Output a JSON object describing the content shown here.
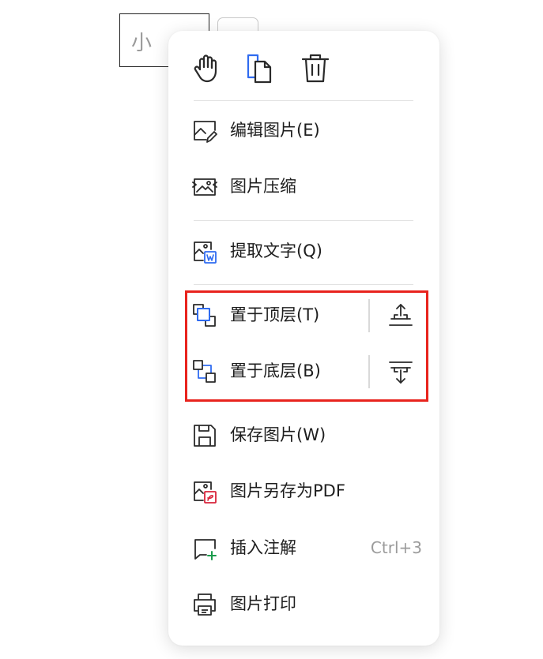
{
  "background": {
    "image_text": "小 花"
  },
  "toolbar_icons": [
    {
      "icon": "hand-icon"
    },
    {
      "icon": "copy-icon",
      "color": "#2f6bf0"
    },
    {
      "icon": "trash-icon"
    }
  ],
  "menu": {
    "items": {
      "edit_image": {
        "label": "编辑图片(E)",
        "icon": "image-edit-icon"
      },
      "compress_image": {
        "label": "图片压缩",
        "icon": "image-compress-icon"
      },
      "extract_text": {
        "label": "提取文字(Q)",
        "icon": "image-to-word-icon",
        "icon_color": "#2f6bf0"
      },
      "bring_to_front": {
        "label": "置于顶层(T)",
        "icon": "bring-to-front-icon",
        "side_icon": "move-up-layer-icon"
      },
      "send_to_back": {
        "label": "置于底层(B)",
        "icon": "send-to-back-icon",
        "side_icon": "move-down-layer-icon"
      },
      "save_image": {
        "label": "保存图片(W)",
        "icon": "save-icon"
      },
      "save_as_pdf": {
        "label": "图片另存为PDF",
        "icon": "image-to-pdf-icon",
        "icon_color": "#d8243b"
      },
      "insert_comment": {
        "label": "插入注解",
        "shortcut": "Ctrl+3",
        "icon": "comment-add-icon",
        "icon_color": "#1a9b4b"
      },
      "print_image": {
        "label": "图片打印",
        "icon": "print-icon"
      }
    }
  },
  "colors": {
    "accent_blue": "#2f6bf0",
    "highlight_red": "#e8231d",
    "text": "#1e1e1e",
    "shortcut_text": "#9b9b9b"
  }
}
